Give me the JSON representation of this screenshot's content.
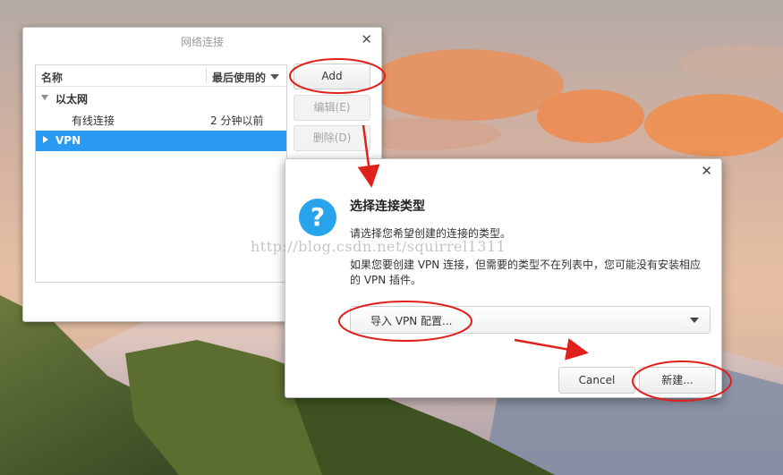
{
  "colors": {
    "selection": "#2b9af3",
    "question_icon": "#28a4ed",
    "annotation": "#e0201b"
  },
  "network_window": {
    "title": "网络连接",
    "close_glyph": "✕",
    "columns": {
      "name": "名称",
      "last_used": "最后使用的"
    },
    "groups": [
      {
        "label": "以太网",
        "expanded": true,
        "children": [
          {
            "name": "有线连接",
            "last_used": "2 分钟以前"
          }
        ]
      },
      {
        "label": "VPN",
        "expanded": false,
        "selected": true
      }
    ],
    "buttons": {
      "add": "Add",
      "edit": "编辑(E)",
      "delete": "删除(D)"
    }
  },
  "choose_dialog": {
    "close_glyph": "✕",
    "icon_glyph": "?",
    "icon": "question-icon",
    "heading": "选择连接类型",
    "line1": "请选择您希望创建的连接的类型。",
    "line2": "如果您要创建 VPN 连接，但需要的类型不在列表中，您可能没有安装相应的 VPN 插件。",
    "combo_value": "导入 VPN 配置...",
    "buttons": {
      "cancel": "Cancel",
      "new": "新建..."
    }
  },
  "watermark": "http://blog.csdn.net/squirrel1311"
}
